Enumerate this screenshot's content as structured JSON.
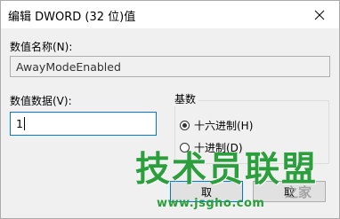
{
  "window": {
    "title": "编辑 DWORD (32 位)值",
    "close_icon": "close-icon"
  },
  "value_name": {
    "label": "数值名称(N):",
    "value": "AwayModeEnabled"
  },
  "value_data": {
    "label": "数值数据(V):",
    "value": "1"
  },
  "base": {
    "title": "基数",
    "options": [
      {
        "label": "十六进制(H)",
        "selected": true
      },
      {
        "label": "十进制(D)",
        "selected": false
      }
    ]
  },
  "buttons": {
    "ok_label": "取",
    "cancel_label": "取"
  },
  "watermark": {
    "main": "技术员联盟",
    "url": "www.jsgho.com",
    "faint": "之家"
  },
  "colors": {
    "accent": "#0078d7",
    "watermark": "#2a9f3c"
  }
}
